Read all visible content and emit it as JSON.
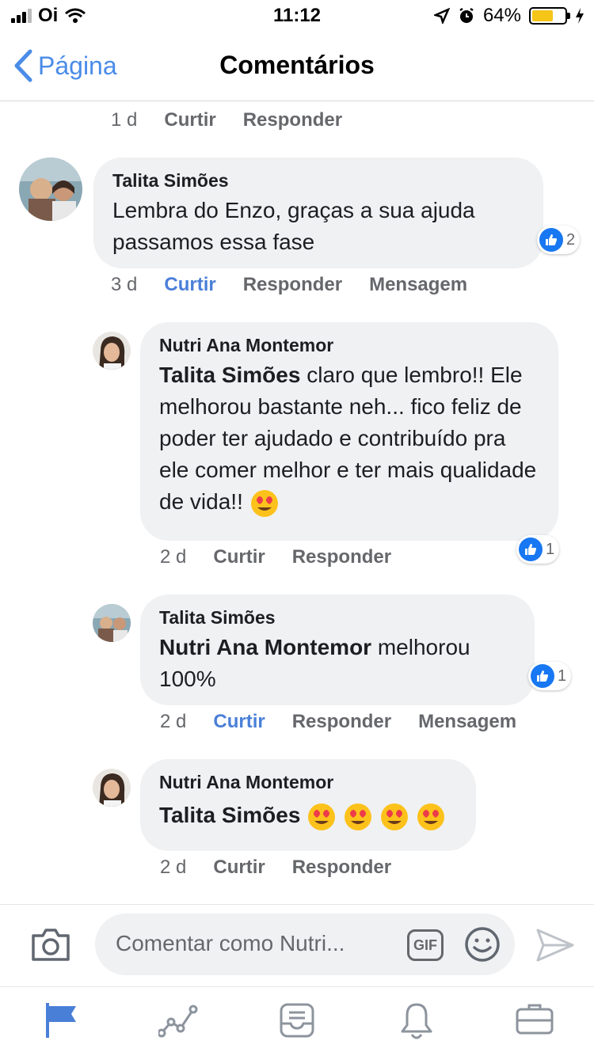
{
  "status": {
    "carrier": "Oi",
    "time": "11:12",
    "battery": "64%"
  },
  "nav": {
    "back_label": "Página",
    "title": "Comentários"
  },
  "top_meta": {
    "time": "1 d",
    "like": "Curtir",
    "reply": "Responder"
  },
  "comments": [
    {
      "author": "Talita Simões",
      "text": "Lembra do Enzo, graças a sua ajuda passamos essa fase",
      "likes": "2",
      "time": "3 d",
      "like": "Curtir",
      "reply": "Responder",
      "message": "Mensagem"
    },
    {
      "author": "Nutri Ana Montemor",
      "mention": "Talita Simões",
      "text": "claro que lembro!! Ele melhorou bastante neh... fico feliz de poder ter ajudado e contribuído pra ele comer melhor e ter mais qualidade de vida!!",
      "likes": "1",
      "time": "2 d",
      "like": "Curtir",
      "reply": "Responder"
    },
    {
      "author": "Talita Simões",
      "mention": "Nutri Ana Montemor",
      "text": "melhorou 100%",
      "likes": "1",
      "time": "2 d",
      "like": "Curtir",
      "reply": "Responder",
      "message": "Mensagem"
    },
    {
      "author": "Nutri Ana Montemor",
      "mention": "Talita Simões",
      "time": "2 d",
      "like": "Curtir",
      "reply": "Responder"
    }
  ],
  "composer": {
    "placeholder": "Comentar como Nutri...",
    "gif_label": "GIF"
  },
  "icons": [
    "camera-icon",
    "gif-icon",
    "smile-icon",
    "send-icon",
    "flag-icon",
    "chart-icon",
    "inbox-icon",
    "bell-icon",
    "briefcase-icon"
  ],
  "colors": {
    "accent": "#4a8ce8",
    "liked": "#4a7fd8",
    "bubble": "#f0f1f3",
    "like_badge": "#1877f2"
  }
}
